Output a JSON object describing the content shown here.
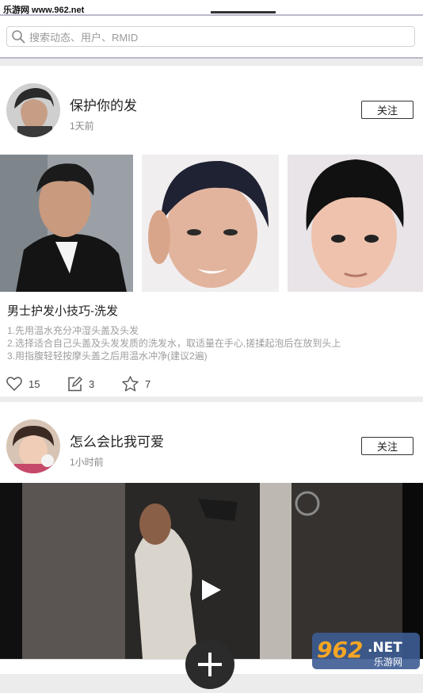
{
  "watermark_top": "乐游网 www.962.net",
  "search": {
    "placeholder": "搜索动态、用户、RMID"
  },
  "posts": [
    {
      "title": "保护你的发",
      "time": "1天前",
      "follow_label": "关注",
      "post_title": "男士护发小技巧-洗发",
      "body_lines": [
        "1.先用温水充分冲湿头盖及头发",
        "2.选择适合自己头盖及头发发质的洗发水，取适量在手心,搓揉起泡后在放到头上",
        "3.用指腹轻轻按摩头盖之后用温水冲净(建议2遍)"
      ],
      "likes": "15",
      "comments": "3",
      "favorites": "7"
    },
    {
      "title": "怎么会比我可爱",
      "time": "1小时前",
      "follow_label": "关注"
    }
  ],
  "logo": {
    "number": "962",
    "suffix": ".NET",
    "subtitle": "乐游网"
  }
}
